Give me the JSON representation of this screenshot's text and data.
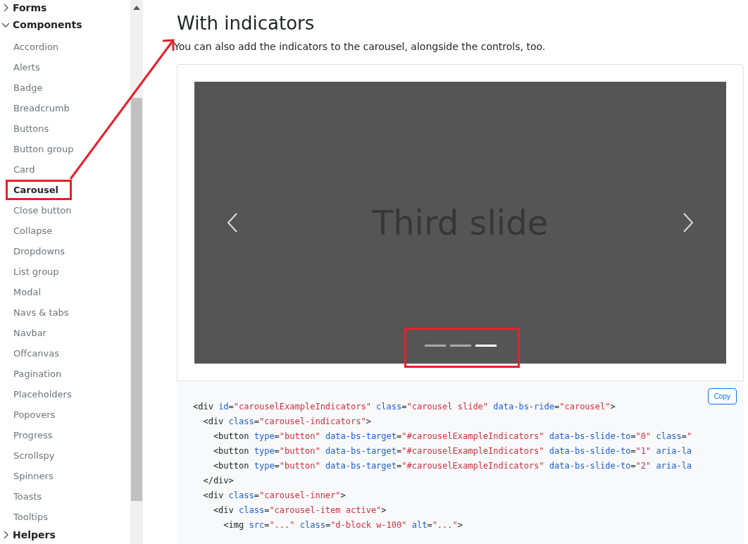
{
  "sidebar": {
    "groups": [
      {
        "label": "Forms",
        "expanded": false
      },
      {
        "label": "Components",
        "expanded": true,
        "items": [
          {
            "label": "Accordion",
            "selected": false
          },
          {
            "label": "Alerts",
            "selected": false
          },
          {
            "label": "Badge",
            "selected": false
          },
          {
            "label": "Breadcrumb",
            "selected": false
          },
          {
            "label": "Buttons",
            "selected": false
          },
          {
            "label": "Button group",
            "selected": false
          },
          {
            "label": "Card",
            "selected": false
          },
          {
            "label": "Carousel",
            "selected": true
          },
          {
            "label": "Close button",
            "selected": false
          },
          {
            "label": "Collapse",
            "selected": false
          },
          {
            "label": "Dropdowns",
            "selected": false
          },
          {
            "label": "List group",
            "selected": false
          },
          {
            "label": "Modal",
            "selected": false
          },
          {
            "label": "Navs & tabs",
            "selected": false
          },
          {
            "label": "Navbar",
            "selected": false
          },
          {
            "label": "Offcanvas",
            "selected": false
          },
          {
            "label": "Pagination",
            "selected": false
          },
          {
            "label": "Placeholders",
            "selected": false
          },
          {
            "label": "Popovers",
            "selected": false
          },
          {
            "label": "Progress",
            "selected": false
          },
          {
            "label": "Scrollspy",
            "selected": false
          },
          {
            "label": "Spinners",
            "selected": false
          },
          {
            "label": "Toasts",
            "selected": false
          },
          {
            "label": "Tooltips",
            "selected": false
          }
        ]
      },
      {
        "label": "Helpers",
        "expanded": false
      }
    ]
  },
  "section": {
    "title": "With indicators",
    "description": "You can also add the indicators to the carousel, alongside the controls, too."
  },
  "carousel": {
    "slide_text": "Third slide",
    "indicators": [
      {
        "selected": false
      },
      {
        "selected": false
      },
      {
        "selected": true
      }
    ]
  },
  "code": {
    "copy_label": "Copy",
    "lines": [
      [
        {
          "kind": "tag",
          "text": "<div "
        },
        {
          "kind": "attr",
          "text": "id"
        },
        {
          "kind": "tag",
          "text": "="
        },
        {
          "kind": "str",
          "text": "\"carouselExampleIndicators\" "
        },
        {
          "kind": "attr",
          "text": "class"
        },
        {
          "kind": "tag",
          "text": "="
        },
        {
          "kind": "str",
          "text": "\"carousel slide\" "
        },
        {
          "kind": "attr",
          "text": "data-bs-ride"
        },
        {
          "kind": "tag",
          "text": "="
        },
        {
          "kind": "str",
          "text": "\"carousel\""
        },
        {
          "kind": "tag",
          "text": ">"
        }
      ],
      [
        {
          "kind": "tag",
          "text": "  <div "
        },
        {
          "kind": "attr",
          "text": "class"
        },
        {
          "kind": "tag",
          "text": "="
        },
        {
          "kind": "str",
          "text": "\"carousel-indicators\""
        },
        {
          "kind": "tag",
          "text": ">"
        }
      ],
      [
        {
          "kind": "tag",
          "text": "    <button "
        },
        {
          "kind": "attr",
          "text": "type"
        },
        {
          "kind": "tag",
          "text": "="
        },
        {
          "kind": "str",
          "text": "\"button\" "
        },
        {
          "kind": "attr",
          "text": "data-bs-target"
        },
        {
          "kind": "tag",
          "text": "="
        },
        {
          "kind": "str",
          "text": "\"#carouselExampleIndicators\" "
        },
        {
          "kind": "attr",
          "text": "data-bs-slide-to"
        },
        {
          "kind": "tag",
          "text": "="
        },
        {
          "kind": "str",
          "text": "\"0\" "
        },
        {
          "kind": "attr",
          "text": "class"
        },
        {
          "kind": "tag",
          "text": "="
        },
        {
          "kind": "str",
          "text": "\""
        }
      ],
      [
        {
          "kind": "tag",
          "text": "    <button "
        },
        {
          "kind": "attr",
          "text": "type"
        },
        {
          "kind": "tag",
          "text": "="
        },
        {
          "kind": "str",
          "text": "\"button\" "
        },
        {
          "kind": "attr",
          "text": "data-bs-target"
        },
        {
          "kind": "tag",
          "text": "="
        },
        {
          "kind": "str",
          "text": "\"#carouselExampleIndicators\" "
        },
        {
          "kind": "attr",
          "text": "data-bs-slide-to"
        },
        {
          "kind": "tag",
          "text": "="
        },
        {
          "kind": "str",
          "text": "\"1\" "
        },
        {
          "kind": "attr",
          "text": "aria-la"
        }
      ],
      [
        {
          "kind": "tag",
          "text": "    <button "
        },
        {
          "kind": "attr",
          "text": "type"
        },
        {
          "kind": "tag",
          "text": "="
        },
        {
          "kind": "str",
          "text": "\"button\" "
        },
        {
          "kind": "attr",
          "text": "data-bs-target"
        },
        {
          "kind": "tag",
          "text": "="
        },
        {
          "kind": "str",
          "text": "\"#carouselExampleIndicators\" "
        },
        {
          "kind": "attr",
          "text": "data-bs-slide-to"
        },
        {
          "kind": "tag",
          "text": "="
        },
        {
          "kind": "str",
          "text": "\"2\" "
        },
        {
          "kind": "attr",
          "text": "aria-la"
        }
      ],
      [
        {
          "kind": "tag",
          "text": "  </div>"
        }
      ],
      [
        {
          "kind": "tag",
          "text": "  <div "
        },
        {
          "kind": "attr",
          "text": "class"
        },
        {
          "kind": "tag",
          "text": "="
        },
        {
          "kind": "str",
          "text": "\"carousel-inner\""
        },
        {
          "kind": "tag",
          "text": ">"
        }
      ],
      [
        {
          "kind": "tag",
          "text": "    <div "
        },
        {
          "kind": "attr",
          "text": "class"
        },
        {
          "kind": "tag",
          "text": "="
        },
        {
          "kind": "str",
          "text": "\"carousel-item active\""
        },
        {
          "kind": "tag",
          "text": ">"
        }
      ],
      [
        {
          "kind": "tag",
          "text": "      <img "
        },
        {
          "kind": "attr",
          "text": "src"
        },
        {
          "kind": "tag",
          "text": "="
        },
        {
          "kind": "str",
          "text": "\"...\" "
        },
        {
          "kind": "attr",
          "text": "class"
        },
        {
          "kind": "tag",
          "text": "="
        },
        {
          "kind": "str",
          "text": "\"d-block w-100\" "
        },
        {
          "kind": "attr",
          "text": "alt"
        },
        {
          "kind": "tag",
          "text": "="
        },
        {
          "kind": "str",
          "text": "\"...\""
        },
        {
          "kind": "tag",
          "text": ">"
        }
      ]
    ]
  }
}
